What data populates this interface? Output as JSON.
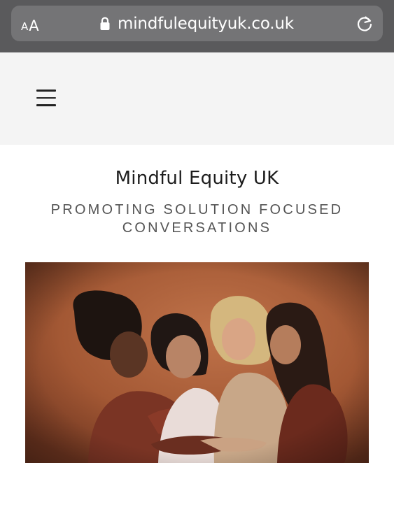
{
  "browser": {
    "aa_small": "A",
    "aa_large": "A",
    "url": "mindfulequityuk.co.uk",
    "icons": {
      "lock": "lock-icon",
      "reload": "reload-icon"
    }
  },
  "header": {
    "menu_icon": "hamburger-icon"
  },
  "site": {
    "title": "Mindful Equity UK",
    "tagline": "PROMOTING SOLUTION FOCUSED CONVERSATIONS"
  },
  "colors": {
    "chrome_bg": "#5a5a5c",
    "url_pill": "#747476",
    "header_bg": "#f4f4f4",
    "hero_bg": "#a45a36"
  }
}
